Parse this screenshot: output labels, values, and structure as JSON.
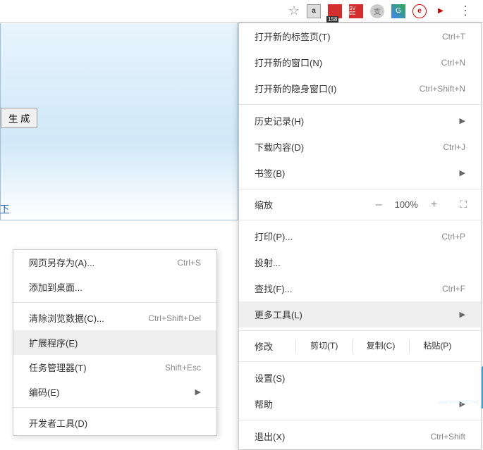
{
  "toolbar": {
    "ext_a": "a",
    "ext_badge": "158",
    "ext_sv": "SV EE",
    "ext_shield": "支",
    "ext_g": "G",
    "ext_e": "e",
    "ext_yt": "▶",
    "menu_dots": "⋮",
    "star": "☆"
  },
  "content": {
    "gen_btn": "生 成",
    "link": "下"
  },
  "menu": {
    "new_tab": {
      "label": "打开新的标签页(T)",
      "shortcut": "Ctrl+T"
    },
    "new_window": {
      "label": "打开新的窗口(N)",
      "shortcut": "Ctrl+N"
    },
    "incognito": {
      "label": "打开新的隐身窗口(I)",
      "shortcut": "Ctrl+Shift+N"
    },
    "history": {
      "label": "历史记录(H)",
      "arrow": "▶"
    },
    "downloads": {
      "label": "下载内容(D)",
      "shortcut": "Ctrl+J"
    },
    "bookmarks": {
      "label": "书签(B)",
      "arrow": "▶"
    },
    "zoom": {
      "label": "缩放",
      "minus": "–",
      "value": "100%",
      "plus": "+",
      "fullscreen": "⛶"
    },
    "print": {
      "label": "打印(P)...",
      "shortcut": "Ctrl+P"
    },
    "cast": {
      "label": "投射..."
    },
    "find": {
      "label": "查找(F)...",
      "shortcut": "Ctrl+F"
    },
    "more_tools": {
      "label": "更多工具(L)",
      "arrow": "▶"
    },
    "edit": {
      "label": "修改",
      "cut": "剪切(T)",
      "copy": "复制(C)",
      "paste": "粘贴(P)"
    },
    "settings": {
      "label": "设置(S)"
    },
    "help": {
      "label": "帮助"
    },
    "exit": {
      "label": "退出(X)",
      "shortcut": "Ctrl+Shift"
    }
  },
  "submenu": {
    "save_as": {
      "label": "网页另存为(A)...",
      "shortcut": "Ctrl+S"
    },
    "add_desktop": {
      "label": "添加到桌面..."
    },
    "clear_data": {
      "label": "清除浏览数据(C)...",
      "shortcut": "Ctrl+Shift+Del"
    },
    "extensions": {
      "label": "扩展程序(E)"
    },
    "task_mgr": {
      "label": "任务管理器(T)",
      "shortcut": "Shift+Esc"
    },
    "encoding": {
      "label": "编码(E)",
      "arrow": "▶"
    },
    "devtools": {
      "label": "开发者工具(D)",
      "shortcut": ""
    }
  },
  "watermark": {
    "cn": "脚本之家",
    "en": "jiaocheng.jb51.net"
  }
}
